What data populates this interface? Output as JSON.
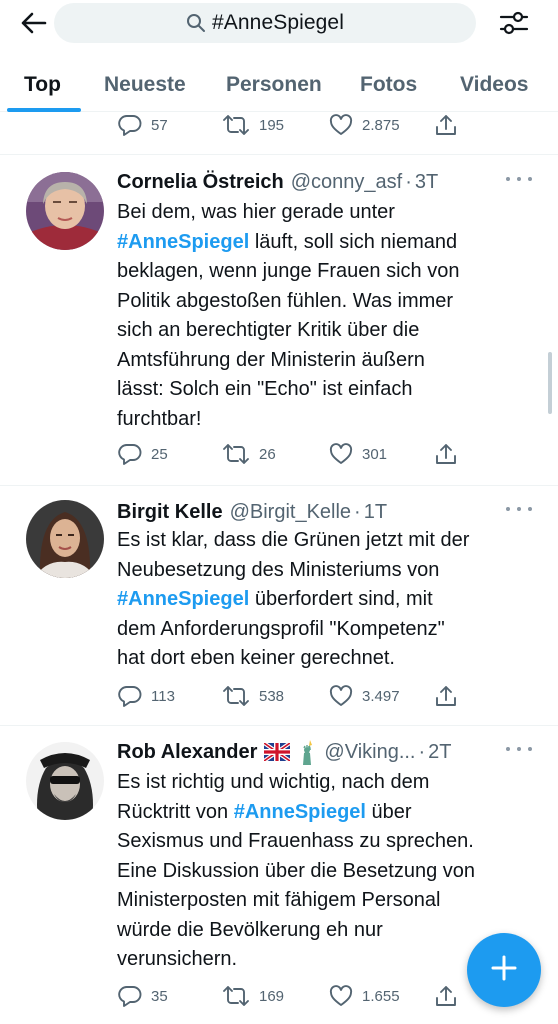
{
  "search": {
    "query": "#AnneSpiegel"
  },
  "tabs": [
    {
      "label": "Top",
      "active": true
    },
    {
      "label": "Neueste"
    },
    {
      "label": "Personen"
    },
    {
      "label": "Fotos"
    },
    {
      "label": "Videos"
    }
  ],
  "prev_tweet": {
    "replies": "57",
    "retweets": "195",
    "likes": "2.875"
  },
  "tweets": [
    {
      "name": "Cornelia Östreich",
      "handle": "@conny_asf",
      "time": "3T",
      "lines": [
        {
          "text": "Bei dem, was hier gerade unter"
        },
        {
          "hashtag": "#AnneSpiegel",
          "text": " läuft, soll sich niemand"
        },
        {
          "text": "beklagen, wenn junge Frauen sich von"
        },
        {
          "text": "Politik abgestoßen fühlen. Was immer"
        },
        {
          "text": "sich an berechtigter Kritik über die"
        },
        {
          "text": "Amtsführung der Ministerin äußern"
        },
        {
          "text": "lässt: Solch ein \"Echo\" ist einfach"
        },
        {
          "text": "furchtbar!"
        }
      ],
      "replies": "25",
      "retweets": "26",
      "likes": "301"
    },
    {
      "name": "Birgit Kelle",
      "handle": "@Birgit_Kelle",
      "time": "1T",
      "lines": [
        {
          "text": "Es ist klar, dass die Grünen jetzt mit der"
        },
        {
          "text": "Neubesetzung des Ministeriums von"
        },
        {
          "hashtag": "#AnneSpiegel",
          "text": " überfordert sind, mit"
        },
        {
          "text": "dem Anforderungsprofil \"Kompetenz\""
        },
        {
          "text": "hat dort eben keiner gerechnet."
        }
      ],
      "replies": "113",
      "retweets": "538",
      "likes": "3.497"
    },
    {
      "name": "Rob Alexander",
      "handle": "@Viking...",
      "time": "2T",
      "flag_icons": [
        "uk-flag-icon",
        "statue-of-liberty-icon"
      ],
      "lines": [
        {
          "text": "Es ist richtig und wichtig, nach dem"
        },
        {
          "text": "Rücktritt von ",
          "hashtag": "#AnneSpiegel",
          "after": " über"
        },
        {
          "text": "Sexismus und Frauenhass zu sprechen."
        },
        {
          "text": "Eine Diskussion über die Besetzung von"
        },
        {
          "text": "Ministerposten mit fähigem Personal"
        },
        {
          "text": "würde die Bevölkerung eh nur"
        },
        {
          "text": "verunsichern."
        }
      ],
      "replies": "35",
      "retweets": "169",
      "likes": "1.655"
    }
  ],
  "colors": {
    "accent": "#1d9bf0",
    "text": "#0f1419",
    "muted": "#536471"
  }
}
